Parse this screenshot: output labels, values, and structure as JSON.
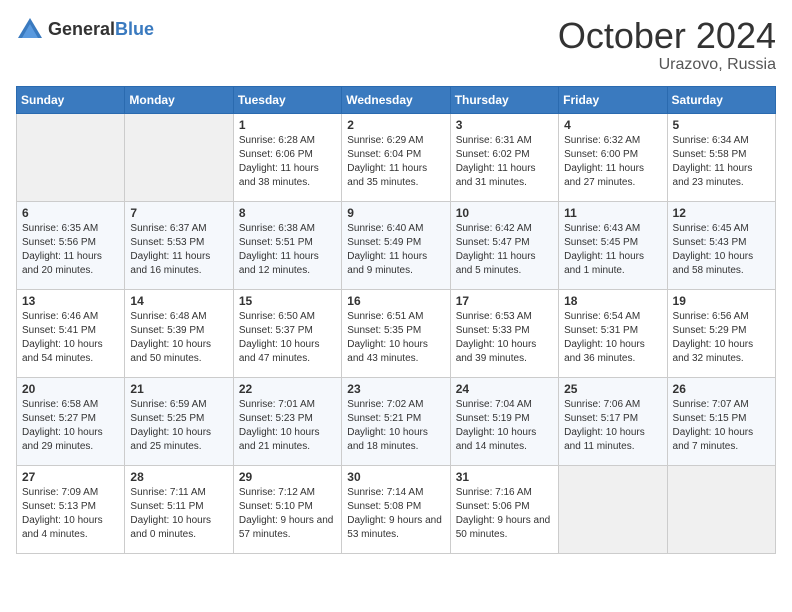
{
  "header": {
    "logo_general": "General",
    "logo_blue": "Blue",
    "month_title": "October 2024",
    "location": "Urazovo, Russia"
  },
  "weekdays": [
    "Sunday",
    "Monday",
    "Tuesday",
    "Wednesday",
    "Thursday",
    "Friday",
    "Saturday"
  ],
  "weeks": [
    [
      {
        "day": "",
        "sunrise": "",
        "sunset": "",
        "daylight": ""
      },
      {
        "day": "",
        "sunrise": "",
        "sunset": "",
        "daylight": ""
      },
      {
        "day": "1",
        "sunrise": "Sunrise: 6:28 AM",
        "sunset": "Sunset: 6:06 PM",
        "daylight": "Daylight: 11 hours and 38 minutes."
      },
      {
        "day": "2",
        "sunrise": "Sunrise: 6:29 AM",
        "sunset": "Sunset: 6:04 PM",
        "daylight": "Daylight: 11 hours and 35 minutes."
      },
      {
        "day": "3",
        "sunrise": "Sunrise: 6:31 AM",
        "sunset": "Sunset: 6:02 PM",
        "daylight": "Daylight: 11 hours and 31 minutes."
      },
      {
        "day": "4",
        "sunrise": "Sunrise: 6:32 AM",
        "sunset": "Sunset: 6:00 PM",
        "daylight": "Daylight: 11 hours and 27 minutes."
      },
      {
        "day": "5",
        "sunrise": "Sunrise: 6:34 AM",
        "sunset": "Sunset: 5:58 PM",
        "daylight": "Daylight: 11 hours and 23 minutes."
      }
    ],
    [
      {
        "day": "6",
        "sunrise": "Sunrise: 6:35 AM",
        "sunset": "Sunset: 5:56 PM",
        "daylight": "Daylight: 11 hours and 20 minutes."
      },
      {
        "day": "7",
        "sunrise": "Sunrise: 6:37 AM",
        "sunset": "Sunset: 5:53 PM",
        "daylight": "Daylight: 11 hours and 16 minutes."
      },
      {
        "day": "8",
        "sunrise": "Sunrise: 6:38 AM",
        "sunset": "Sunset: 5:51 PM",
        "daylight": "Daylight: 11 hours and 12 minutes."
      },
      {
        "day": "9",
        "sunrise": "Sunrise: 6:40 AM",
        "sunset": "Sunset: 5:49 PM",
        "daylight": "Daylight: 11 hours and 9 minutes."
      },
      {
        "day": "10",
        "sunrise": "Sunrise: 6:42 AM",
        "sunset": "Sunset: 5:47 PM",
        "daylight": "Daylight: 11 hours and 5 minutes."
      },
      {
        "day": "11",
        "sunrise": "Sunrise: 6:43 AM",
        "sunset": "Sunset: 5:45 PM",
        "daylight": "Daylight: 11 hours and 1 minute."
      },
      {
        "day": "12",
        "sunrise": "Sunrise: 6:45 AM",
        "sunset": "Sunset: 5:43 PM",
        "daylight": "Daylight: 10 hours and 58 minutes."
      }
    ],
    [
      {
        "day": "13",
        "sunrise": "Sunrise: 6:46 AM",
        "sunset": "Sunset: 5:41 PM",
        "daylight": "Daylight: 10 hours and 54 minutes."
      },
      {
        "day": "14",
        "sunrise": "Sunrise: 6:48 AM",
        "sunset": "Sunset: 5:39 PM",
        "daylight": "Daylight: 10 hours and 50 minutes."
      },
      {
        "day": "15",
        "sunrise": "Sunrise: 6:50 AM",
        "sunset": "Sunset: 5:37 PM",
        "daylight": "Daylight: 10 hours and 47 minutes."
      },
      {
        "day": "16",
        "sunrise": "Sunrise: 6:51 AM",
        "sunset": "Sunset: 5:35 PM",
        "daylight": "Daylight: 10 hours and 43 minutes."
      },
      {
        "day": "17",
        "sunrise": "Sunrise: 6:53 AM",
        "sunset": "Sunset: 5:33 PM",
        "daylight": "Daylight: 10 hours and 39 minutes."
      },
      {
        "day": "18",
        "sunrise": "Sunrise: 6:54 AM",
        "sunset": "Sunset: 5:31 PM",
        "daylight": "Daylight: 10 hours and 36 minutes."
      },
      {
        "day": "19",
        "sunrise": "Sunrise: 6:56 AM",
        "sunset": "Sunset: 5:29 PM",
        "daylight": "Daylight: 10 hours and 32 minutes."
      }
    ],
    [
      {
        "day": "20",
        "sunrise": "Sunrise: 6:58 AM",
        "sunset": "Sunset: 5:27 PM",
        "daylight": "Daylight: 10 hours and 29 minutes."
      },
      {
        "day": "21",
        "sunrise": "Sunrise: 6:59 AM",
        "sunset": "Sunset: 5:25 PM",
        "daylight": "Daylight: 10 hours and 25 minutes."
      },
      {
        "day": "22",
        "sunrise": "Sunrise: 7:01 AM",
        "sunset": "Sunset: 5:23 PM",
        "daylight": "Daylight: 10 hours and 21 minutes."
      },
      {
        "day": "23",
        "sunrise": "Sunrise: 7:02 AM",
        "sunset": "Sunset: 5:21 PM",
        "daylight": "Daylight: 10 hours and 18 minutes."
      },
      {
        "day": "24",
        "sunrise": "Sunrise: 7:04 AM",
        "sunset": "Sunset: 5:19 PM",
        "daylight": "Daylight: 10 hours and 14 minutes."
      },
      {
        "day": "25",
        "sunrise": "Sunrise: 7:06 AM",
        "sunset": "Sunset: 5:17 PM",
        "daylight": "Daylight: 10 hours and 11 minutes."
      },
      {
        "day": "26",
        "sunrise": "Sunrise: 7:07 AM",
        "sunset": "Sunset: 5:15 PM",
        "daylight": "Daylight: 10 hours and 7 minutes."
      }
    ],
    [
      {
        "day": "27",
        "sunrise": "Sunrise: 7:09 AM",
        "sunset": "Sunset: 5:13 PM",
        "daylight": "Daylight: 10 hours and 4 minutes."
      },
      {
        "day": "28",
        "sunrise": "Sunrise: 7:11 AM",
        "sunset": "Sunset: 5:11 PM",
        "daylight": "Daylight: 10 hours and 0 minutes."
      },
      {
        "day": "29",
        "sunrise": "Sunrise: 7:12 AM",
        "sunset": "Sunset: 5:10 PM",
        "daylight": "Daylight: 9 hours and 57 minutes."
      },
      {
        "day": "30",
        "sunrise": "Sunrise: 7:14 AM",
        "sunset": "Sunset: 5:08 PM",
        "daylight": "Daylight: 9 hours and 53 minutes."
      },
      {
        "day": "31",
        "sunrise": "Sunrise: 7:16 AM",
        "sunset": "Sunset: 5:06 PM",
        "daylight": "Daylight: 9 hours and 50 minutes."
      },
      {
        "day": "",
        "sunrise": "",
        "sunset": "",
        "daylight": ""
      },
      {
        "day": "",
        "sunrise": "",
        "sunset": "",
        "daylight": ""
      }
    ]
  ]
}
